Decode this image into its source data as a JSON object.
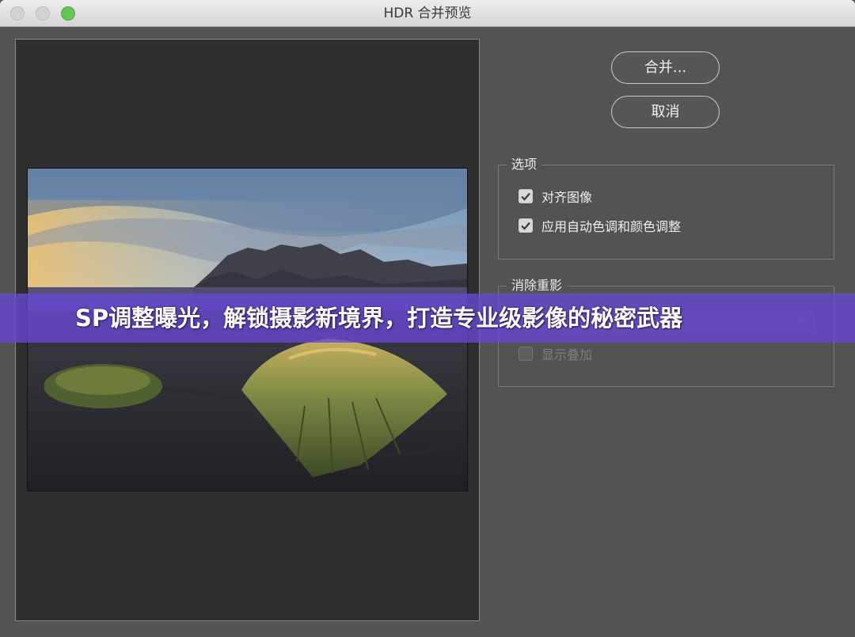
{
  "window": {
    "title": "HDR 合并预览"
  },
  "buttons": {
    "merge_label": "合并...",
    "cancel_label": "取消"
  },
  "options": {
    "legend": "选项",
    "items": [
      {
        "label": "对齐图像",
        "checked": true
      },
      {
        "label": "应用自动色调和颜色调整",
        "checked": true
      }
    ]
  },
  "ghost_removal": {
    "legend": "消除重影",
    "show_overlay_label": "显示叠加",
    "show_overlay_checked": false,
    "enabled": false
  },
  "banner": {
    "text": "SP调整曝光，解锁摄影新境界，打造专业级影像的秘密武器"
  },
  "colors": {
    "banner": "#6846d2",
    "zoom_button": "#62c654",
    "panel_bg": "#535353"
  }
}
